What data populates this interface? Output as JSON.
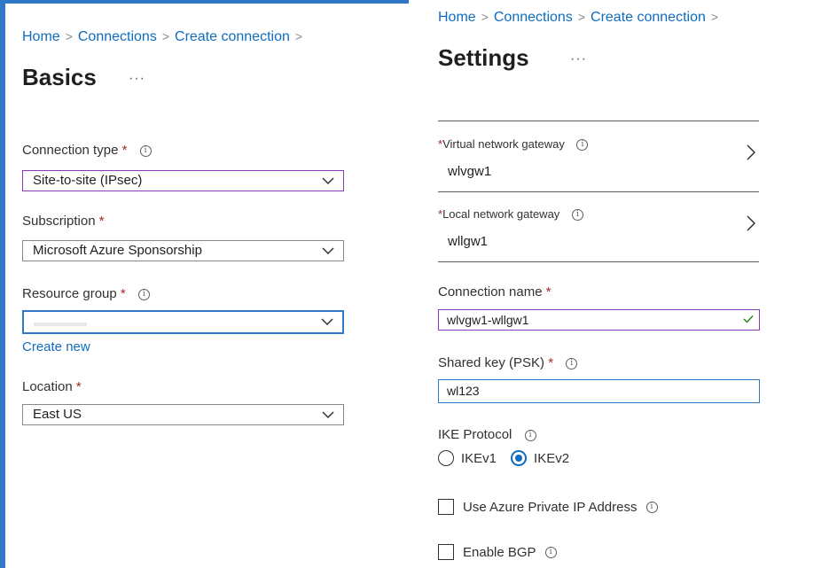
{
  "left": {
    "breadcrumb": [
      "Home",
      "Connections",
      "Create connection"
    ],
    "title": "Basics",
    "more": "···",
    "connection_type": {
      "label": "Connection type",
      "value": "Site-to-site (IPsec)"
    },
    "subscription": {
      "label": "Subscription",
      "value": "Microsoft Azure Sponsorship"
    },
    "resource_group": {
      "label": "Resource group",
      "value": "",
      "create_new": "Create new"
    },
    "location": {
      "label": "Location",
      "value": "East US"
    }
  },
  "right": {
    "breadcrumb": [
      "Home",
      "Connections",
      "Create connection"
    ],
    "title": "Settings",
    "more": "···",
    "virtual_gateway": {
      "label": "Virtual network gateway",
      "value": "wlvgw1"
    },
    "local_gateway": {
      "label": "Local network gateway",
      "value": "wllgw1"
    },
    "connection_name": {
      "label": "Connection name",
      "value": "wlvgw1-wllgw1"
    },
    "shared_key": {
      "label": "Shared key (PSK)",
      "value": "wl123"
    },
    "ike": {
      "label": "IKE Protocol",
      "options": [
        "IKEv1",
        "IKEv2"
      ],
      "selected": "IKEv2"
    },
    "private_ip": {
      "label": "Use Azure Private IP Address",
      "checked": false
    },
    "bgp": {
      "label": "Enable BGP",
      "checked": false
    }
  },
  "common": {
    "required": "*",
    "info_icon": "i"
  },
  "colors": {
    "accent": "#2f77c7",
    "link": "#0f6cbd",
    "required": "#a4262c",
    "valid": "#107c10",
    "focus_purple": "#8a3ab9"
  }
}
